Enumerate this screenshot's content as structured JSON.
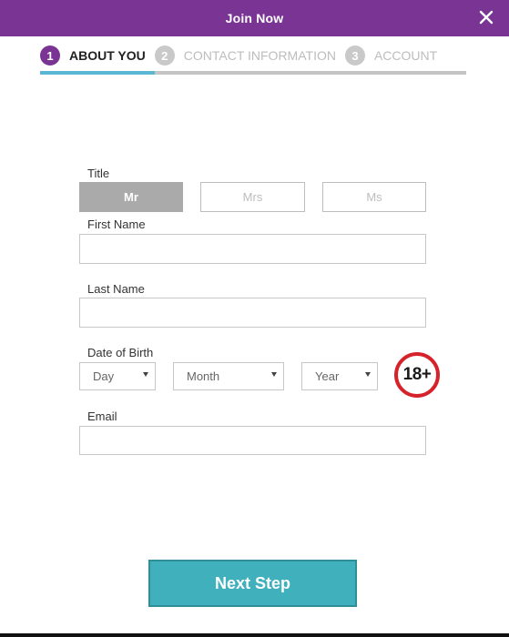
{
  "header": {
    "title": "Join Now",
    "close_icon": "close-icon",
    "background_color": "#7a3594"
  },
  "stepper": {
    "steps": [
      {
        "number": "1",
        "label": "ABOUT YOU",
        "state": "active"
      },
      {
        "number": "2",
        "label": "CONTACT INFORMATION",
        "state": "inactive"
      },
      {
        "number": "3",
        "label": "ACCOUNT",
        "state": "inactive"
      }
    ],
    "progress_fraction": 0.27,
    "accent_color": "#7a3594",
    "progress_color": "#5bb6d5"
  },
  "form": {
    "title_label": "Title",
    "title_options": [
      "Mr",
      "Mrs",
      "Ms"
    ],
    "title_selected": "Mr",
    "first_name_label": "First Name",
    "first_name_value": "",
    "last_name_label": "Last Name",
    "last_name_value": "",
    "dob_label": "Date of Birth",
    "dob_day": "Day",
    "dob_month": "Month",
    "dob_year": "Year",
    "age_badge": "18+",
    "age_badge_color": "#d6232b",
    "email_label": "Email",
    "email_value": ""
  },
  "footer": {
    "next_button": "Next Step",
    "button_color": "#3fb0bc"
  }
}
